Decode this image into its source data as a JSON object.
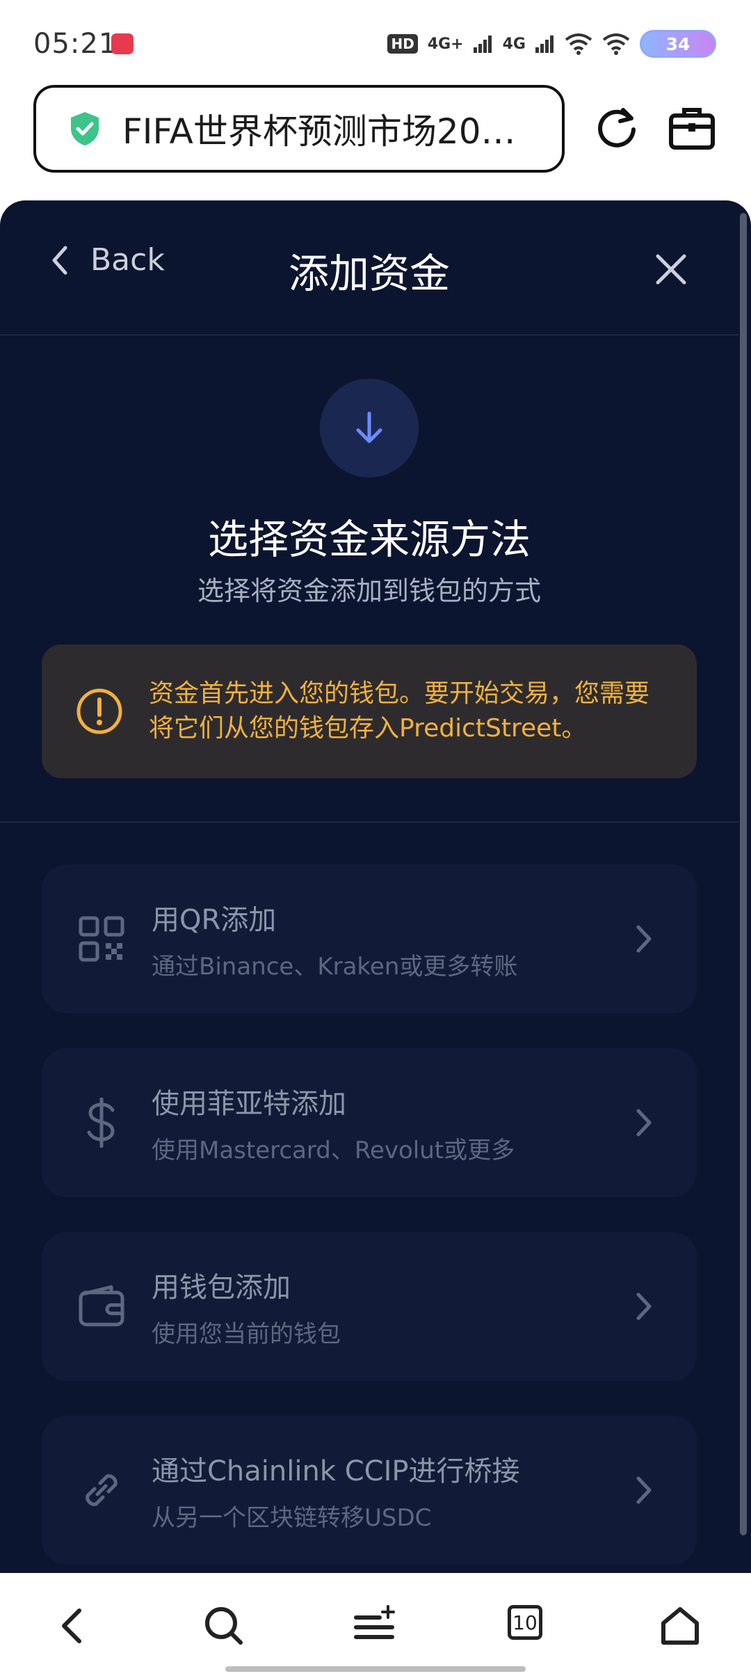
{
  "status_bar": {
    "time": "05:21",
    "hd_label": "HD",
    "network_1": "4G+",
    "network_2": "4G",
    "battery": "34"
  },
  "browser": {
    "url_title": "FIFA世界杯预测市场20…"
  },
  "sheet": {
    "back_label": "Back",
    "title": "添加资金",
    "heading": "选择资金来源方法",
    "subheading": "选择将资金添加到钱包的方式",
    "warning": "资金首先进入您的钱包。要开始交易，您需要将它们从您的钱包存入PredictStreet。",
    "options": [
      {
        "title": "用QR添加",
        "desc": "通过Binance、Kraken或更多转账",
        "icon": "qr-code-icon"
      },
      {
        "title": "使用菲亚特添加",
        "desc": "使用Mastercard、Revolut或更多",
        "icon": "dollar-icon"
      },
      {
        "title": "用钱包添加",
        "desc": "使用您当前的钱包",
        "icon": "wallet-icon"
      },
      {
        "title": "通过Chainlink CCIP进行桥接",
        "desc": "从另一个区块链转移USDC",
        "icon": "link-icon"
      }
    ]
  },
  "bottom_nav": {
    "tab_count": "10"
  },
  "colors": {
    "sheet_bg": "#0c1530",
    "card_bg": "#111b38",
    "warning_bg": "#2e2b2f",
    "warning_text": "#f0b13d",
    "accent_blue": "#6d8bff",
    "shield_green": "#3cc48a"
  }
}
